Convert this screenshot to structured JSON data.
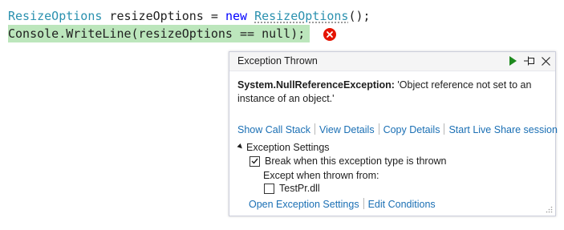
{
  "code": {
    "line1": {
      "type1": "ResizeOptions",
      "variable": " resizeOptions = ",
      "keyword": "new",
      "space": " ",
      "type2": "ResizeOptions",
      "tail": "();"
    },
    "line2": {
      "text": "Console.WriteLine(resizeOptions == null);"
    },
    "colors": {
      "type": "#2b91af",
      "keyword": "#0000ff",
      "highlight": "#bce6bc",
      "error": "#e51400"
    },
    "error_icon": "error-x-icon"
  },
  "popup": {
    "title": "Exception Thrown",
    "header_icons": [
      "continue-icon",
      "pin-icon",
      "close-icon"
    ],
    "exception_type": "System.NullReferenceException:",
    "exception_message": " 'Object reference not set to an instance of an object.'",
    "links": {
      "call_stack": "Show Call Stack",
      "view_details": "View Details",
      "copy_details": "Copy Details",
      "live_share": "Start Live Share session"
    },
    "settings": {
      "header": "Exception Settings",
      "break_label": "Break when this exception type is thrown",
      "break_checked": true,
      "except_label": "Except when thrown from:",
      "dll_label": "TestPr.dll",
      "dll_checked": false
    },
    "footer": {
      "open_settings": "Open Exception Settings",
      "edit_conditions": "Edit Conditions"
    },
    "link_color": "#1a6fb4"
  }
}
